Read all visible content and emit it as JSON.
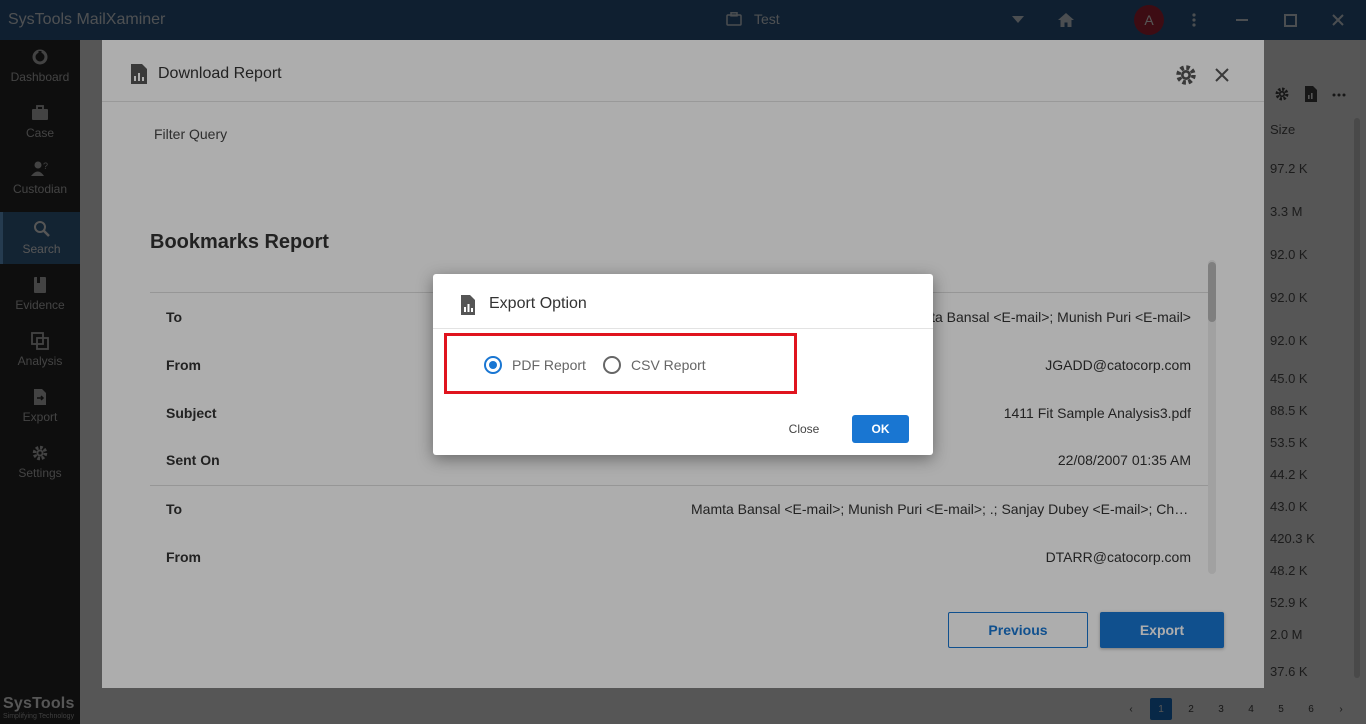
{
  "app": {
    "title": "SysTools MailXaminer"
  },
  "case": {
    "name": "Test"
  },
  "user": {
    "avatar_letter": "A"
  },
  "colors": {
    "titlebar": "#2f5f8f",
    "sidebar": "#2a2a2a",
    "accent": "#1976d2",
    "highlight": "#e0141e",
    "avatar": "#b5273b"
  },
  "sidebar": {
    "items": [
      {
        "label": "Dashboard",
        "icon": "dashboard-icon"
      },
      {
        "label": "Case",
        "icon": "briefcase-icon"
      },
      {
        "label": "Custodian",
        "icon": "custodian-icon"
      },
      {
        "label": "Search",
        "icon": "search-icon"
      },
      {
        "label": "Evidence",
        "icon": "evidence-icon"
      },
      {
        "label": "Analysis",
        "icon": "analysis-icon"
      },
      {
        "label": "Export",
        "icon": "export-icon"
      },
      {
        "label": "Settings",
        "icon": "gear-icon"
      }
    ],
    "active": "Search",
    "brand": {
      "name": "SysTools",
      "tagline": "Simplifying Technology"
    }
  },
  "background": {
    "size_header": "Size",
    "sizes": [
      "97.2 K",
      "3.3 M",
      "92.0 K",
      "92.0 K",
      "92.0 K",
      "45.0 K",
      "88.5 K",
      "53.5 K",
      "44.2 K",
      "43.0 K",
      "420.3 K",
      "48.2 K",
      "52.9 K",
      "2.0 M",
      "37.6 K"
    ],
    "pages": [
      "1",
      "2",
      "3",
      "4",
      "5",
      "6"
    ],
    "current_page": "1"
  },
  "download_dialog": {
    "title": "Download Report",
    "filter_label": "Filter Query",
    "report_title": "Bookmarks Report",
    "rows": [
      {
        "label": "To",
        "value": "<E-mail>; Mamta Bansal <E-mail>; Munish Puri <E-mail>"
      },
      {
        "label": "From",
        "value": "JGADD@catocorp.com"
      },
      {
        "label": "Subject",
        "value": "1411 Fit Sample Analysis3.pdf"
      },
      {
        "label": "Sent On",
        "value": "22/08/2007 01:35 AM"
      },
      {
        "label": "To",
        "value": "Mamta Bansal <E-mail>; Munish Puri <E-mail>; .; Sanjay Dubey <E-mail>; Chetan"
      },
      {
        "label": "From",
        "value": "DTARR@catocorp.com"
      }
    ],
    "previous_label": "Previous",
    "export_label": "Export"
  },
  "export_modal": {
    "title": "Export Option",
    "options": [
      {
        "label": "PDF Report",
        "selected": true
      },
      {
        "label": "CSV Report",
        "selected": false
      }
    ],
    "close_label": "Close",
    "ok_label": "OK"
  }
}
